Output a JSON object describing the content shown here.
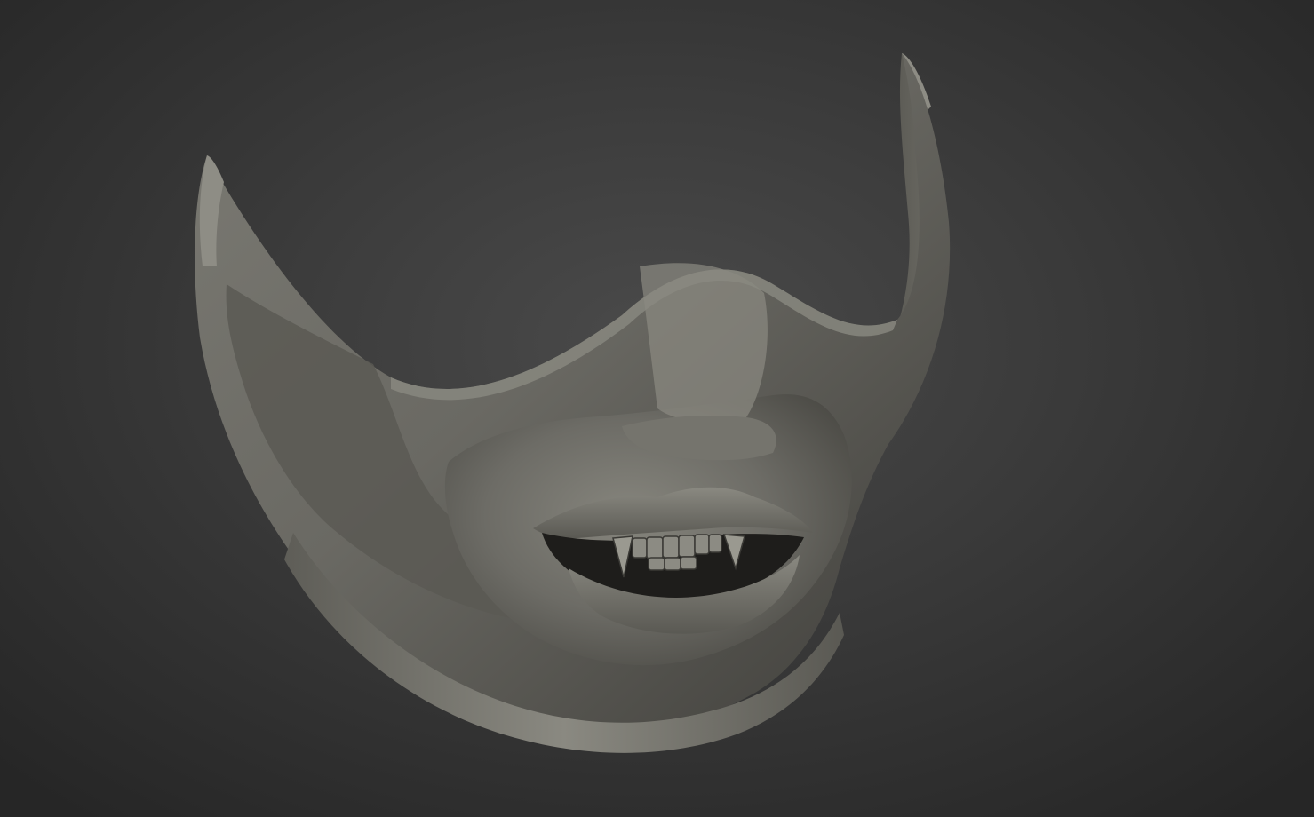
{
  "viewport": {
    "background_color": "#3a3a3a",
    "subject": "half-face-mask-3d-model",
    "material_color": "#6f6e68"
  }
}
